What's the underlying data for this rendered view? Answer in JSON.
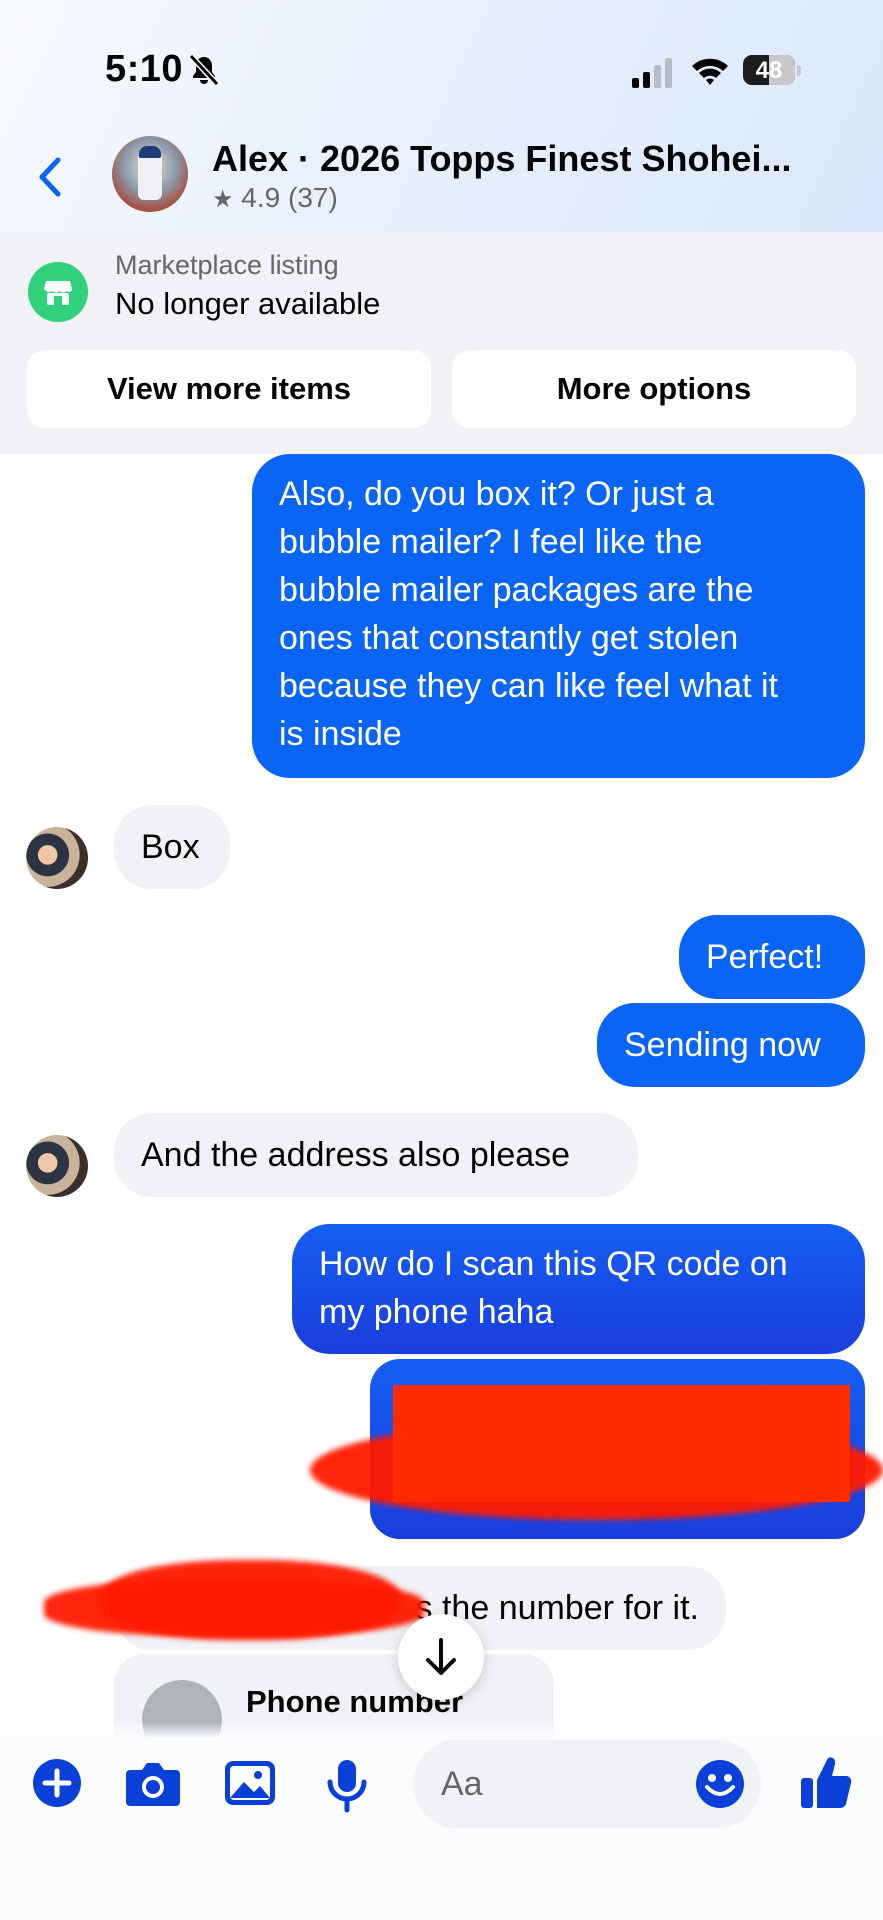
{
  "status_bar": {
    "time": "5:10",
    "battery": "48"
  },
  "header": {
    "title": "Alex · 2026 Topps Finest Shohei...",
    "rating": "4.9 (37)"
  },
  "listing": {
    "label": "Marketplace listing",
    "status": "No longer available",
    "view_more": "View more items",
    "more_options": "More options"
  },
  "messages": {
    "m1_lines": [
      "Also, do you box it? Or just a",
      "bubble mailer? I feel like the",
      "bubble mailer packages are the",
      "ones that constantly get stolen",
      "because they can like feel what it",
      "is inside"
    ],
    "m2": "Box",
    "m3": "Perfect!",
    "m4": "Sending now",
    "m5": "And the address also please",
    "m6_lines": [
      "How do I scan this QR code on",
      "my phone haha"
    ],
    "m8_visible": "s the number for it.",
    "phone_card_label": "Phone number"
  },
  "composer": {
    "placeholder": "Aa"
  },
  "colors": {
    "accent": "#0a65f4",
    "icon_blue": "#0a3fd8",
    "listing_green": "#31d07a",
    "redaction": "#ff2a00"
  },
  "icons": [
    "back-icon",
    "star-icon",
    "store-icon",
    "arrow-down-icon",
    "plus-icon",
    "camera-icon",
    "gallery-icon",
    "mic-icon",
    "emoji-icon",
    "thumbs-up-icon"
  ]
}
